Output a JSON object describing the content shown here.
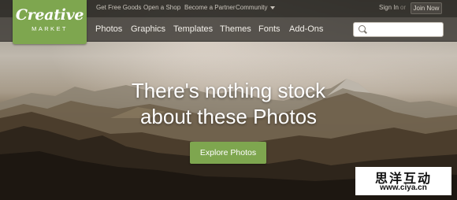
{
  "brand": {
    "logo_line1": "Creative",
    "logo_line2": "MARKET",
    "accent": "#7ea64f"
  },
  "topbar": {
    "links": [
      "Get Free Goods",
      "Open a Shop",
      "Become a Partner",
      "Community"
    ],
    "sign_in": "Sign In",
    "or": "or",
    "join": "Join Now"
  },
  "nav": {
    "items": [
      "Photos",
      "Graphics",
      "Templates",
      "Themes",
      "Fonts",
      "Add-Ons"
    ]
  },
  "search": {
    "icon": "search-icon",
    "placeholder": ""
  },
  "hero": {
    "headline_line1": "There's nothing stock",
    "headline_line2": "about these Photos",
    "cta": "Explore Photos"
  },
  "watermark": {
    "line1": "思洋互动",
    "line2": "www.ciya.cn"
  }
}
